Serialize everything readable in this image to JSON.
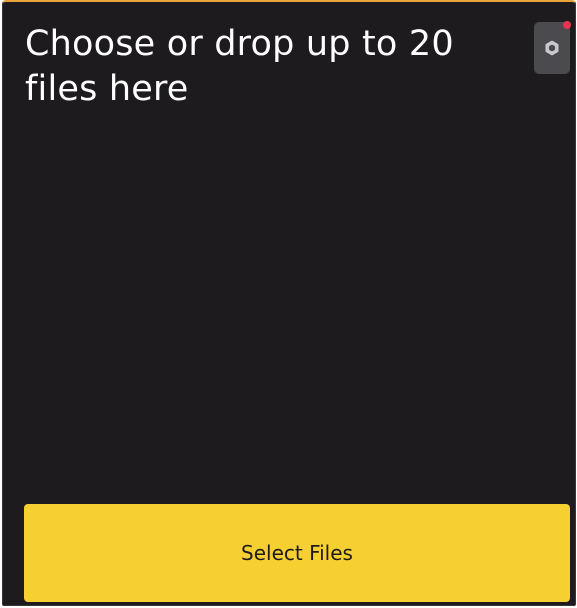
{
  "dropzone": {
    "title": "Choose or drop up to 20 files here"
  },
  "settings": {
    "icon": "gear-icon",
    "has_notification": true
  },
  "actions": {
    "select_files_label": "Select Files"
  },
  "colors": {
    "panel_bg": "#1d1b1e",
    "accent_border": "#e8a33a",
    "button_bg": "#f6d030",
    "settings_bg": "#4b4a4f",
    "notification_dot": "#e8334a"
  }
}
